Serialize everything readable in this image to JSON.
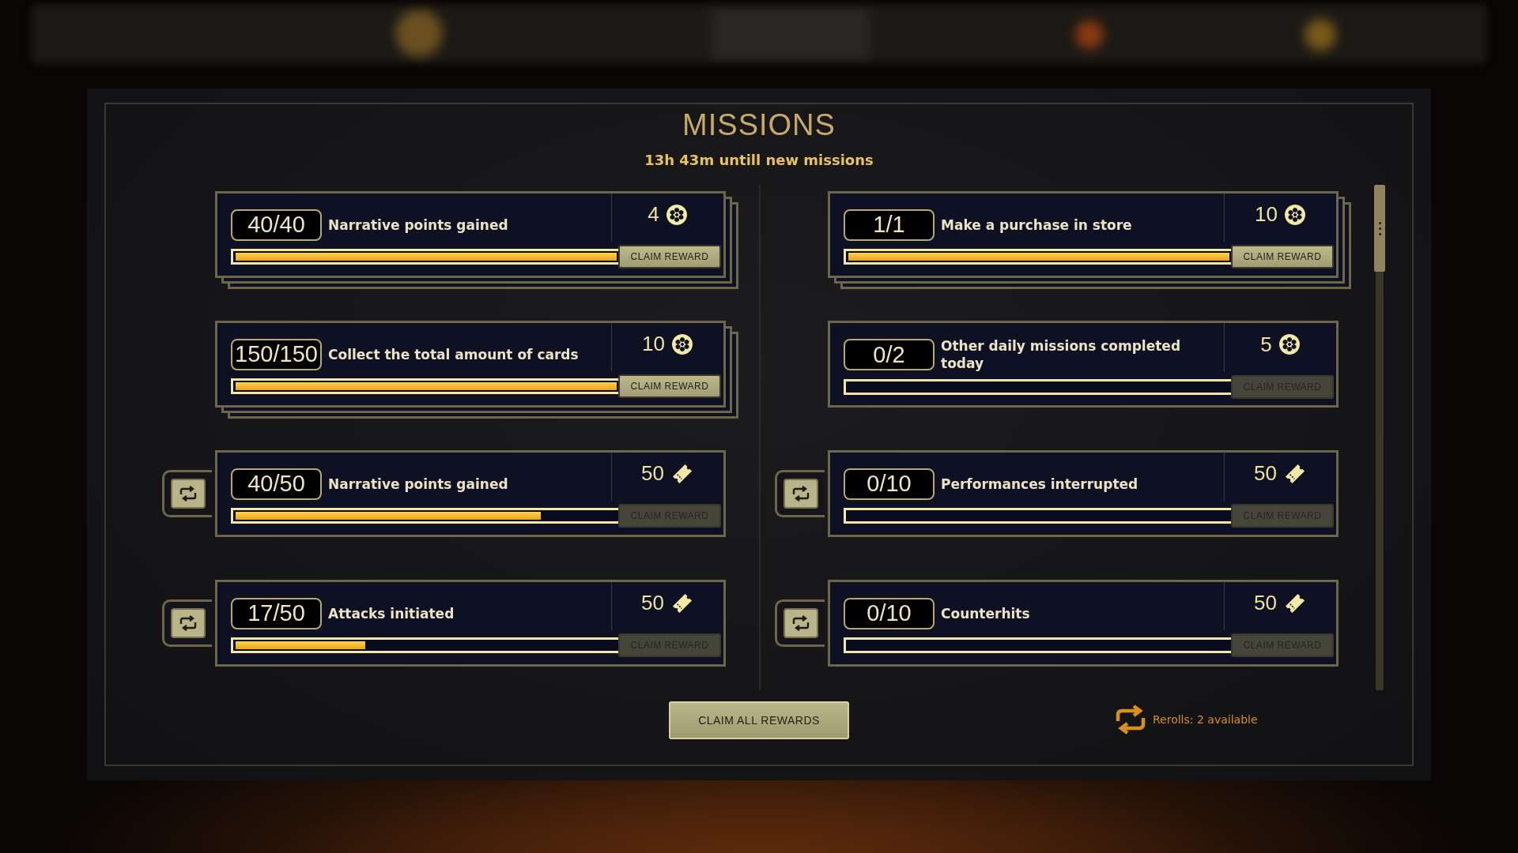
{
  "title": "MISSIONS",
  "subtitle": "13h 43m untill new missions",
  "mission_columns": [
    {
      "missions": [
        {
          "progress": "40/40",
          "text": "Narrative points gained",
          "reward": {
            "amount": "4",
            "kind": "coin"
          },
          "level": 1,
          "claim_label": "CLAIM REWARD",
          "claimable": true,
          "stacked": true,
          "rerollable": false
        },
        {
          "progress": "150/150",
          "text": "Collect the total amount of cards",
          "reward": {
            "amount": "10",
            "kind": "coin"
          },
          "level": 1,
          "claim_label": "CLAIM REWARD",
          "claimable": true,
          "stacked": true,
          "rerollable": false
        },
        {
          "progress": "40/50",
          "text": "Narrative points gained",
          "reward": {
            "amount": "50",
            "kind": "ticket"
          },
          "level": 0.8,
          "claim_label": "CLAIM REWARD",
          "claimable": false,
          "stacked": false,
          "rerollable": true
        },
        {
          "progress": "17/50",
          "text": "Attacks initiated",
          "reward": {
            "amount": "50",
            "kind": "ticket"
          },
          "level": 0.34,
          "claim_label": "CLAIM REWARD",
          "claimable": false,
          "stacked": false,
          "rerollable": true
        }
      ]
    },
    {
      "missions": [
        {
          "progress": "1/1",
          "text": "Make a purchase in store",
          "reward": {
            "amount": "10",
            "kind": "coin"
          },
          "level": 1,
          "claim_label": "CLAIM REWARD",
          "claimable": true,
          "stacked": true,
          "rerollable": false
        },
        {
          "progress": "0/2",
          "text": "Other daily missions completed today",
          "reward": {
            "amount": "5",
            "kind": "coin"
          },
          "level": 0,
          "claim_label": "CLAIM REWARD",
          "claimable": false,
          "stacked": false,
          "rerollable": false
        },
        {
          "progress": "0/10",
          "text": "Performances interrupted",
          "reward": {
            "amount": "50",
            "kind": "ticket"
          },
          "level": 0,
          "claim_label": "CLAIM REWARD",
          "claimable": false,
          "stacked": false,
          "rerollable": true
        },
        {
          "progress": "0/10",
          "text": "Counterhits",
          "reward": {
            "amount": "50",
            "kind": "ticket"
          },
          "level": 0,
          "claim_label": "CLAIM REWARD",
          "claimable": false,
          "stacked": false,
          "rerollable": true
        }
      ]
    }
  ],
  "claim_all": {
    "label": "CLAIM ALL REWARDS"
  },
  "rerolls": {
    "text": "Rerolls: 2 available"
  }
}
